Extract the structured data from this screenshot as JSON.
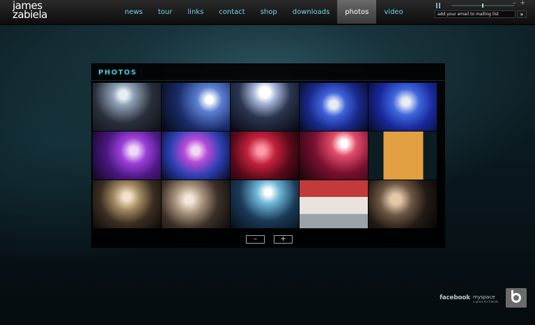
{
  "site": {
    "logo_line1": "james",
    "logo_line2": "zabiela"
  },
  "nav": {
    "items": [
      {
        "label": "news"
      },
      {
        "label": "tour"
      },
      {
        "label": "links"
      },
      {
        "label": "contact"
      },
      {
        "label": "shop"
      },
      {
        "label": "downloads"
      },
      {
        "label": "photos",
        "active": true
      },
      {
        "label": "video"
      }
    ]
  },
  "player": {
    "pause_icon": "pause-icon",
    "minus_label": "–",
    "plus_label": "+"
  },
  "mailing": {
    "placeholder": "add your email to mailing list",
    "submit_label": "»"
  },
  "photos": {
    "title": "PHOTOS",
    "thumbs": [
      {
        "icon": "photo-thumbnail"
      },
      {
        "icon": "photo-thumbnail"
      },
      {
        "icon": "photo-thumbnail"
      },
      {
        "icon": "photo-thumbnail"
      },
      {
        "icon": "photo-thumbnail"
      },
      {
        "icon": "photo-thumbnail"
      },
      {
        "icon": "photo-thumbnail"
      },
      {
        "icon": "photo-thumbnail"
      },
      {
        "icon": "photo-thumbnail"
      },
      {
        "icon": "photo-thumbnail"
      },
      {
        "icon": "photo-thumbnail"
      },
      {
        "icon": "photo-thumbnail"
      },
      {
        "icon": "photo-thumbnail"
      },
      {
        "icon": "photo-thumbnail"
      },
      {
        "icon": "photo-thumbnail"
      }
    ],
    "prev_label": "–",
    "next_label": "+"
  },
  "footer": {
    "facebook_label": "facebook",
    "myspace_label": "myspace",
    "myspace_tagline": "a place for friends",
    "bebo_icon": "bebo-icon"
  },
  "colors": {
    "accent": "#43c9e6",
    "nav_text": "#6fd6ee",
    "background": "#0a1a20"
  }
}
